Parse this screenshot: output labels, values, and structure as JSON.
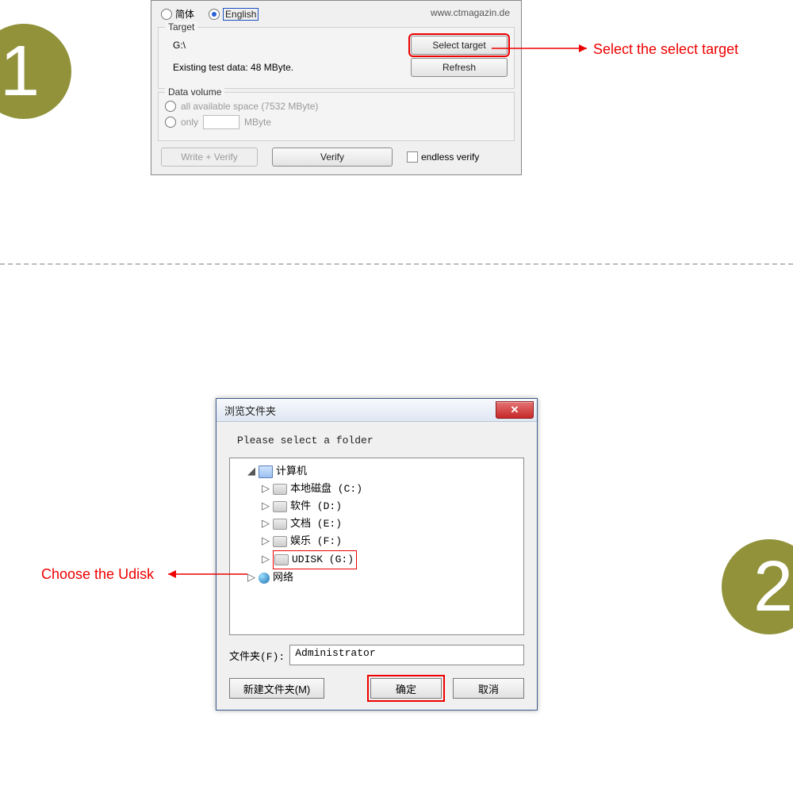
{
  "step1": {
    "badge": "1"
  },
  "step2": {
    "badge": "2"
  },
  "annotations": {
    "a1": "Select the select target",
    "a2": "Choose the Udisk"
  },
  "panel1": {
    "lang_cn": "简体",
    "lang_en": "English",
    "website": "www.ctmagazin.de",
    "target_label": "Target",
    "target_path": "G:\\",
    "select_target_btn": "Select target",
    "existing_text": "Existing test data: 48 MByte.",
    "refresh_btn": "Refresh",
    "datavol_label": "Data volume",
    "allspace": "all available space (7532 MByte)",
    "only_label": "only",
    "only_unit": "MByte",
    "write_verify_btn": "Write + Verify",
    "verify_btn": "Verify",
    "endless_label": "endless verify"
  },
  "panel2": {
    "title": "浏览文件夹",
    "instruction": "Please select a folder",
    "computer": "计算机",
    "drives": {
      "c": "本地磁盘 (C:)",
      "d": "软件 (D:)",
      "e": "文档 (E:)",
      "f": "娱乐 (F:)",
      "g": "UDISK (G:)"
    },
    "network": "网络",
    "folder_label": "文件夹(F):",
    "folder_value": "Administrator",
    "new_folder_btn": "新建文件夹(M)",
    "ok_btn": "确定",
    "cancel_btn": "取消"
  }
}
